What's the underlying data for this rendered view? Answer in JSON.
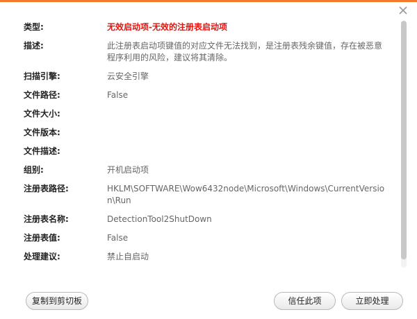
{
  "dialog": {
    "accent_color": "#f57a2b",
    "close_icon": "close-icon"
  },
  "details": [
    {
      "label": "类型:",
      "value": "无效启动项-无效的注册表启动项",
      "value_color": "#e8120c"
    },
    {
      "label": "描述:",
      "value": "此注册表启动项键值的对应文件无法找到，是注册表残余键值，存在被恶意程序利用的风险，建议将其清除。"
    },
    {
      "label": "扫描引擎:",
      "value": "云安全引擎"
    },
    {
      "label": "文件路径:",
      "value": "False"
    },
    {
      "label": "文件大小:",
      "value": ""
    },
    {
      "label": "文件版本:",
      "value": ""
    },
    {
      "label": "文件描述:",
      "value": ""
    },
    {
      "label": "组别:",
      "value": "开机启动项"
    },
    {
      "label": "注册表路径:",
      "value": "HKLM\\SOFTWARE\\Wow6432node\\Microsoft\\Windows\\CurrentVersion\\Run"
    },
    {
      "label": "注册表名称:",
      "value": "DetectionTool2ShutDown"
    },
    {
      "label": "注册表值:",
      "value": "False"
    },
    {
      "label": "处理建议:",
      "value": "禁止自启动"
    }
  ],
  "buttons": {
    "copy_label": "复制到剪切板",
    "trust_label": "信任此项",
    "fix_label": "立即处理"
  }
}
